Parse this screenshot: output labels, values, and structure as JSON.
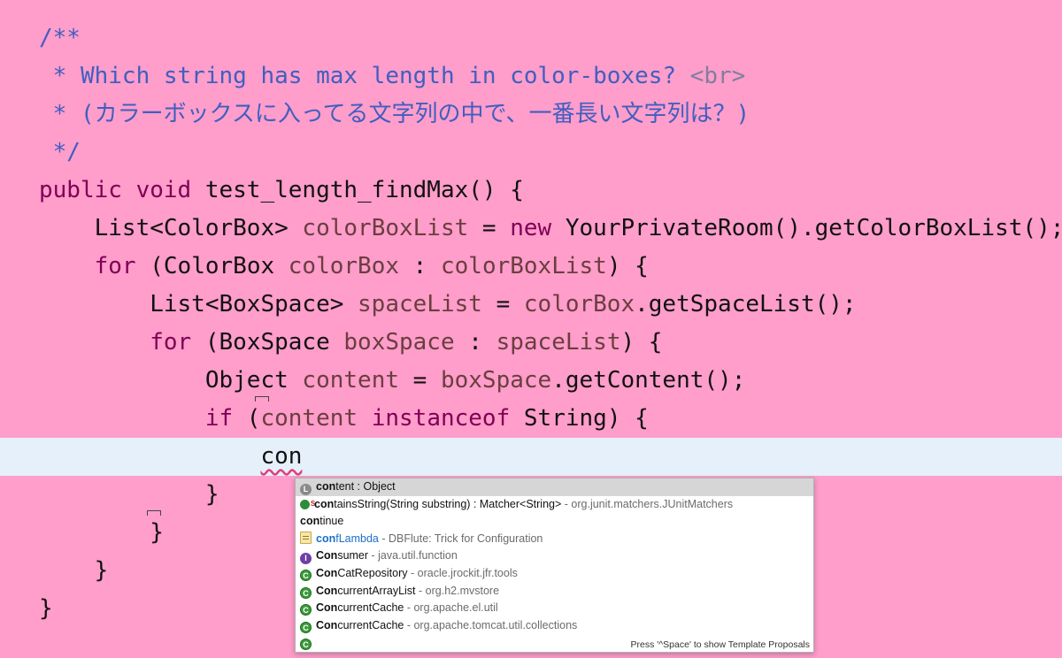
{
  "code_lines": [
    {
      "segments": [
        {
          "t": "/**",
          "c": "comment"
        }
      ]
    },
    {
      "segments": [
        {
          "t": " * Which string has max length in color-boxes? ",
          "c": "comment"
        },
        {
          "t": "<br>",
          "c": "comment-tag"
        }
      ]
    },
    {
      "segments": [
        {
          "t": " * (カラーボックスに入ってる文字列の中で、一番長い文字列は？)",
          "c": "comment"
        }
      ]
    },
    {
      "segments": [
        {
          "t": " */",
          "c": "comment"
        }
      ]
    },
    {
      "segments": [
        {
          "t": "public void ",
          "c": "kw"
        },
        {
          "t": "test_length_findMax() {",
          "c": "plain"
        }
      ]
    },
    {
      "segments": [
        {
          "t": "    List<ColorBox> ",
          "c": "plain"
        },
        {
          "t": "colorBoxList",
          "c": "var"
        },
        {
          "t": " = ",
          "c": "plain"
        },
        {
          "t": "new ",
          "c": "kw"
        },
        {
          "t": "YourPrivateRoom().getColorBoxList();",
          "c": "plain"
        }
      ]
    },
    {
      "segments": [
        {
          "t": "    ",
          "c": "plain"
        },
        {
          "t": "for",
          "c": "kw"
        },
        {
          "t": " (ColorBox ",
          "c": "plain"
        },
        {
          "t": "colorBox",
          "c": "var"
        },
        {
          "t": " : ",
          "c": "plain"
        },
        {
          "t": "colorBoxList",
          "c": "var"
        },
        {
          "t": ") {",
          "c": "plain"
        }
      ]
    },
    {
      "segments": [
        {
          "t": "        List<BoxSpace> ",
          "c": "plain"
        },
        {
          "t": "spaceList",
          "c": "var"
        },
        {
          "t": " = ",
          "c": "plain"
        },
        {
          "t": "colorBox",
          "c": "var"
        },
        {
          "t": ".getSpaceList();",
          "c": "plain"
        }
      ]
    },
    {
      "segments": [
        {
          "t": "        ",
          "c": "plain"
        },
        {
          "t": "for",
          "c": "kw"
        },
        {
          "t": " (BoxSpace ",
          "c": "plain"
        },
        {
          "t": "boxSpace",
          "c": "var"
        },
        {
          "t": " : ",
          "c": "plain"
        },
        {
          "t": "spaceList",
          "c": "var"
        },
        {
          "t": ") {",
          "c": "plain"
        }
      ]
    },
    {
      "segments": [
        {
          "t": "            Object ",
          "c": "plain"
        },
        {
          "t": "content",
          "c": "var"
        },
        {
          "t": " = ",
          "c": "plain"
        },
        {
          "t": "boxSpace",
          "c": "var"
        },
        {
          "t": ".getContent();",
          "c": "plain"
        }
      ]
    },
    {
      "segments": [
        {
          "t": "            ",
          "c": "plain"
        },
        {
          "t": "if",
          "c": "kw"
        },
        {
          "t": " (",
          "c": "plain"
        },
        {
          "t": "content",
          "c": "var"
        },
        {
          "t": " ",
          "c": "plain"
        },
        {
          "t": "instanceof",
          "c": "kw"
        },
        {
          "t": " String) {",
          "c": "plain"
        }
      ]
    },
    {
      "current": true,
      "segments": [
        {
          "t": "                ",
          "c": "plain"
        },
        {
          "t": "con",
          "c": "typing"
        }
      ]
    },
    {
      "segments": [
        {
          "t": "            }",
          "c": "plain"
        }
      ]
    },
    {
      "segments": [
        {
          "t": "        }",
          "c": "plain"
        }
      ]
    },
    {
      "segments": [
        {
          "t": "    }",
          "c": "plain"
        }
      ]
    },
    {
      "segments": [
        {
          "t": "}",
          "c": "plain"
        }
      ]
    }
  ],
  "autocomplete": {
    "proposals": [
      {
        "icon": "local-variable-icon",
        "match": "con",
        "rest": "tent : Object",
        "detail": "",
        "selected": true
      },
      {
        "icon": "static-method-icon",
        "match": "con",
        "rest": "tainsString(String substring) : Matcher<String>",
        "detail": " - org.junit.matchers.JUnitMatchers"
      },
      {
        "icon": "",
        "match": "con",
        "rest": "tinue",
        "detail": ""
      },
      {
        "icon": "template-icon",
        "match": "con",
        "rest": "fLambda",
        "detail": " - DBFlute: Trick for Configuration",
        "blue": true
      },
      {
        "icon": "interface-icon",
        "match": "Con",
        "rest": "sumer",
        "detail": " - java.util.function"
      },
      {
        "icon": "class-icon",
        "match": "Con",
        "rest": "CatRepository",
        "detail": " - oracle.jrockit.jfr.tools"
      },
      {
        "icon": "class-icon",
        "match": "Con",
        "rest": "currentArrayList",
        "detail": " - org.h2.mvstore"
      },
      {
        "icon": "class-icon",
        "match": "Con",
        "rest": "currentCache",
        "detail": " - org.apache.el.util"
      },
      {
        "icon": "class-icon",
        "match": "Con",
        "rest": "currentCache",
        "detail": " - org.apache.tomcat.util.collections"
      },
      {
        "icon": "class-icon",
        "match": "",
        "rest": "",
        "detail": ""
      }
    ],
    "hint": "Press '^Space' to show Template Proposals"
  },
  "colors": {
    "editor_bg": "#ff9dcb",
    "current_line": "#e6f0fa",
    "keyword": "#7f0055",
    "comment": "#3f5fbf",
    "variable": "#6a3e3e"
  }
}
